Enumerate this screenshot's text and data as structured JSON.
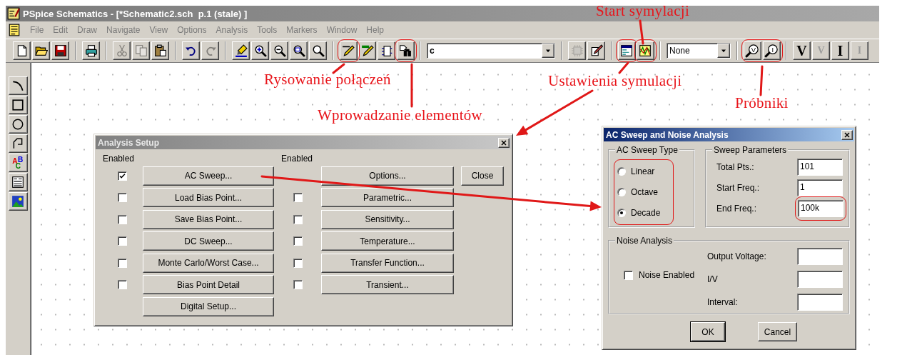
{
  "window": {
    "title": "PSpice Schematics - [*Schematic2.sch  p.1 (stale) ]"
  },
  "menu": [
    "File",
    "Edit",
    "Draw",
    "Navigate",
    "View",
    "Options",
    "Analysis",
    "Tools",
    "Markers",
    "Window",
    "Help"
  ],
  "toolbar": [
    {
      "kind": "new",
      "disabled": false
    },
    {
      "kind": "open",
      "disabled": false
    },
    {
      "kind": "save",
      "disabled": false
    },
    {
      "kind": "separator"
    },
    {
      "kind": "print",
      "disabled": false
    },
    {
      "kind": "separator"
    },
    {
      "kind": "cut",
      "disabled": true
    },
    {
      "kind": "copy",
      "disabled": true
    },
    {
      "kind": "paste",
      "disabled": false
    },
    {
      "kind": "separator"
    },
    {
      "kind": "undo",
      "disabled": false
    },
    {
      "kind": "redo",
      "disabled": true
    },
    {
      "kind": "separator"
    },
    {
      "kind": "marker",
      "disabled": false
    },
    {
      "kind": "zoom_in",
      "disabled": false
    },
    {
      "kind": "zoom_out",
      "disabled": false
    },
    {
      "kind": "zoom_area",
      "disabled": false
    },
    {
      "kind": "zoom_fit",
      "disabled": false
    },
    {
      "kind": "separator"
    },
    {
      "kind": "circled",
      "items": [
        {
          "kind": "wire",
          "disabled": false
        }
      ]
    },
    {
      "kind": "bus",
      "disabled": false
    },
    {
      "kind": "block",
      "disabled": false
    },
    {
      "kind": "circled",
      "items": [
        {
          "kind": "get_part",
          "disabled": false
        }
      ]
    },
    {
      "kind": "separator"
    },
    {
      "kind": "combo",
      "value": "c"
    },
    {
      "kind": "separator"
    },
    {
      "kind": "chip",
      "disabled": true
    },
    {
      "kind": "edit_symbol",
      "disabled": false
    },
    {
      "kind": "separator"
    },
    {
      "kind": "circled",
      "items": [
        {
          "kind": "setup",
          "disabled": false
        }
      ]
    },
    {
      "kind": "circled",
      "items": [
        {
          "kind": "simulate",
          "disabled": false
        }
      ]
    },
    {
      "kind": "separator"
    },
    {
      "kind": "combo",
      "value": "None"
    },
    {
      "kind": "separator"
    },
    {
      "kind": "circled",
      "items": [
        {
          "kind": "probe",
          "label": "V",
          "disabled": false
        },
        {
          "kind": "probe",
          "label": "I",
          "disabled": false
        }
      ]
    },
    {
      "kind": "separator"
    },
    {
      "kind": "letter",
      "label": "V",
      "disabled": false
    },
    {
      "kind": "letter",
      "label": "V",
      "disabled": true
    },
    {
      "kind": "letter",
      "label": "I",
      "disabled": false
    },
    {
      "kind": "letter",
      "label": "I",
      "disabled": true
    }
  ],
  "palette": [
    {
      "kind": "arc"
    },
    {
      "kind": "box"
    },
    {
      "kind": "circle"
    },
    {
      "kind": "polyline"
    },
    {
      "kind": "text",
      "label": "ABC"
    },
    {
      "kind": "text_box"
    },
    {
      "kind": "image_insert"
    }
  ],
  "analysis_setup": {
    "title": "Analysis Setup",
    "left_header": "Enabled",
    "right_header": "Enabled",
    "left": [
      {
        "kind": "checkbox_row",
        "label": "AC Sweep...",
        "checked": true
      },
      {
        "kind": "checkbox_row",
        "label": "Load Bias Point...",
        "checked": false
      },
      {
        "kind": "checkbox_row",
        "label": "Save Bias Point...",
        "checked": false
      },
      {
        "kind": "checkbox_row",
        "label": "DC Sweep...",
        "checked": false
      },
      {
        "kind": "checkbox_row",
        "label": "Monte Carlo/Worst Case...",
        "checked": false
      },
      {
        "kind": "checkbox_row",
        "label": "Bias Point Detail",
        "checked": false
      },
      {
        "kind": "button_row",
        "label": "Digital Setup..."
      }
    ],
    "right": [
      {
        "kind": "button_row",
        "label": "Options..."
      },
      {
        "kind": "checkbox_row",
        "label": "Parametric...",
        "checked": false
      },
      {
        "kind": "checkbox_row",
        "label": "Sensitivity...",
        "checked": false
      },
      {
        "kind": "checkbox_row",
        "label": "Temperature...",
        "checked": false
      },
      {
        "kind": "checkbox_row",
        "label": "Transfer Function...",
        "checked": false
      },
      {
        "kind": "checkbox_row",
        "label": "Transient...",
        "checked": false
      }
    ],
    "close_button": "Close"
  },
  "ac_dialog": {
    "title": "AC Sweep and Noise Analysis",
    "sweep_type": {
      "legend": "AC Sweep Type",
      "circled": true,
      "options": [
        {
          "label": "Linear",
          "selected": false
        },
        {
          "label": "Octave",
          "selected": false
        },
        {
          "label": "Decade",
          "selected": true
        }
      ]
    },
    "sweep_parameters": {
      "legend": "Sweep Parameters",
      "fields": [
        {
          "label": "Total Pts.:",
          "value": "101",
          "circled": false
        },
        {
          "label": "Start Freq.:",
          "value": "1",
          "circled": false
        },
        {
          "label": "End Freq.:",
          "value": "100k",
          "circled": true
        }
      ]
    },
    "noise": {
      "legend": "Noise Analysis",
      "checkbox": {
        "label": "Noise Enabled",
        "checked": false
      },
      "fields": [
        {
          "label": "Output Voltage:"
        },
        {
          "label": "I/V"
        },
        {
          "label": "Interval:"
        }
      ]
    },
    "buttons": [
      "OK",
      "Cancel"
    ]
  },
  "annotations": [
    {
      "text": "Start symylacji"
    },
    {
      "text": "Rysowanie połączeń"
    },
    {
      "text": "Ustawienia symulacji"
    },
    {
      "text": "Próbniki"
    },
    {
      "text": "Wprowadzanie elementów"
    }
  ]
}
